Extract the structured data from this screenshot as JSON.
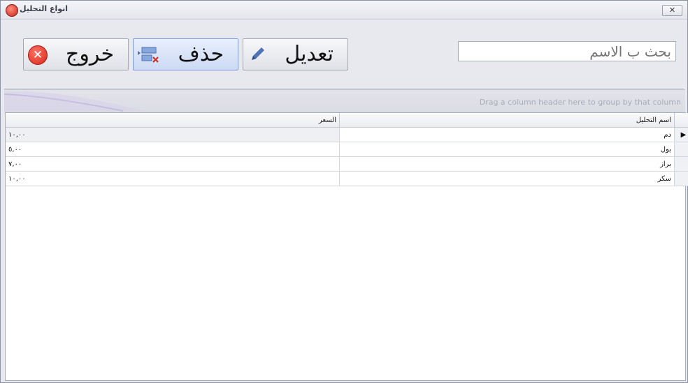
{
  "window": {
    "title": "انواع التحليل",
    "close_label": "✕"
  },
  "toolbar": {
    "exit_label": "خروج",
    "delete_label": "حذف",
    "edit_label": "تعديل",
    "search_placeholder": "بحث ب الاسم"
  },
  "group_panel": {
    "hint": "Drag a column header here to group by that column"
  },
  "grid": {
    "columns": {
      "price": "السعر",
      "name": "اسم التحليل"
    },
    "rows": [
      {
        "name": "دم",
        "price": "١٠,٠٠"
      },
      {
        "name": "بول",
        "price": "٥,٠٠"
      },
      {
        "name": "براز",
        "price": "٧,٠٠"
      },
      {
        "name": "سكر",
        "price": "١٠,٠٠"
      }
    ],
    "selected_row_indicator": "▶"
  },
  "colors": {
    "accent": "#7e9bd6",
    "exit_red": "#d42617"
  }
}
